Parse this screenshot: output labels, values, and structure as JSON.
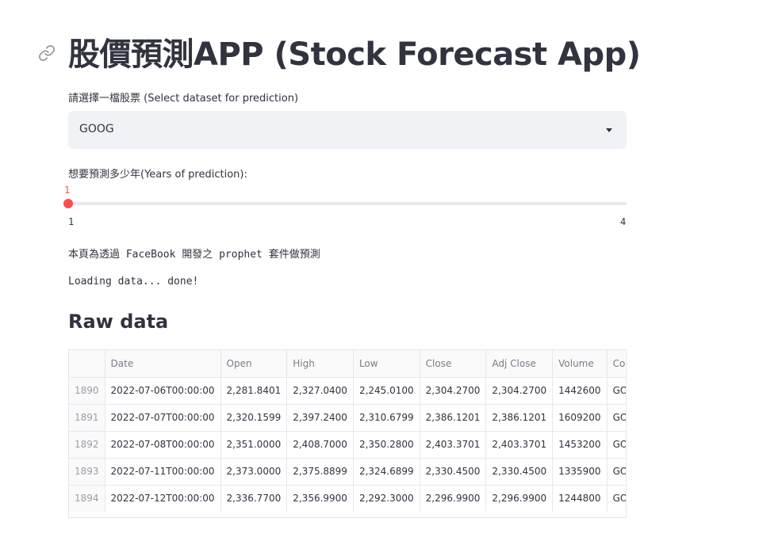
{
  "title": "股價預測APP (Stock Forecast App)",
  "select": {
    "label": "請選擇一檔股票 (Select dataset for prediction)",
    "value": "GOOG"
  },
  "slider": {
    "label": "想要預測多少年(Years of prediction):",
    "current": "1",
    "min": "1",
    "max": "4",
    "value_fraction": 0
  },
  "info_text": "本頁為透過 FaceBook 開發之 prophet 套件做預測",
  "loading_text": "Loading data... done!",
  "raw_data": {
    "heading": "Raw data",
    "columns": [
      "",
      "Date",
      "Open",
      "High",
      "Low",
      "Close",
      "Adj Close",
      "Volume",
      "Company"
    ],
    "rows": [
      [
        "1890",
        "2022-07-06T00:00:00",
        "2,281.8401",
        "2,327.0400",
        "2,245.0100",
        "2,304.2700",
        "2,304.2700",
        "1442600",
        "GOOG"
      ],
      [
        "1891",
        "2022-07-07T00:00:00",
        "2,320.1599",
        "2,397.2400",
        "2,310.6799",
        "2,386.1201",
        "2,386.1201",
        "1609200",
        "GOOG"
      ],
      [
        "1892",
        "2022-07-08T00:00:00",
        "2,351.0000",
        "2,408.7000",
        "2,350.2800",
        "2,403.3701",
        "2,403.3701",
        "1453200",
        "GOOG"
      ],
      [
        "1893",
        "2022-07-11T00:00:00",
        "2,373.0000",
        "2,375.8899",
        "2,324.6899",
        "2,330.4500",
        "2,330.4500",
        "1335900",
        "GOOG"
      ],
      [
        "1894",
        "2022-07-12T00:00:00",
        "2,336.7700",
        "2,356.9900",
        "2,292.3000",
        "2,296.9900",
        "2,296.9900",
        "1244800",
        "GOOG"
      ]
    ]
  },
  "colors": {
    "accent": "#ff4b4b",
    "text": "#31333f",
    "input_bg": "#f0f2f6"
  }
}
